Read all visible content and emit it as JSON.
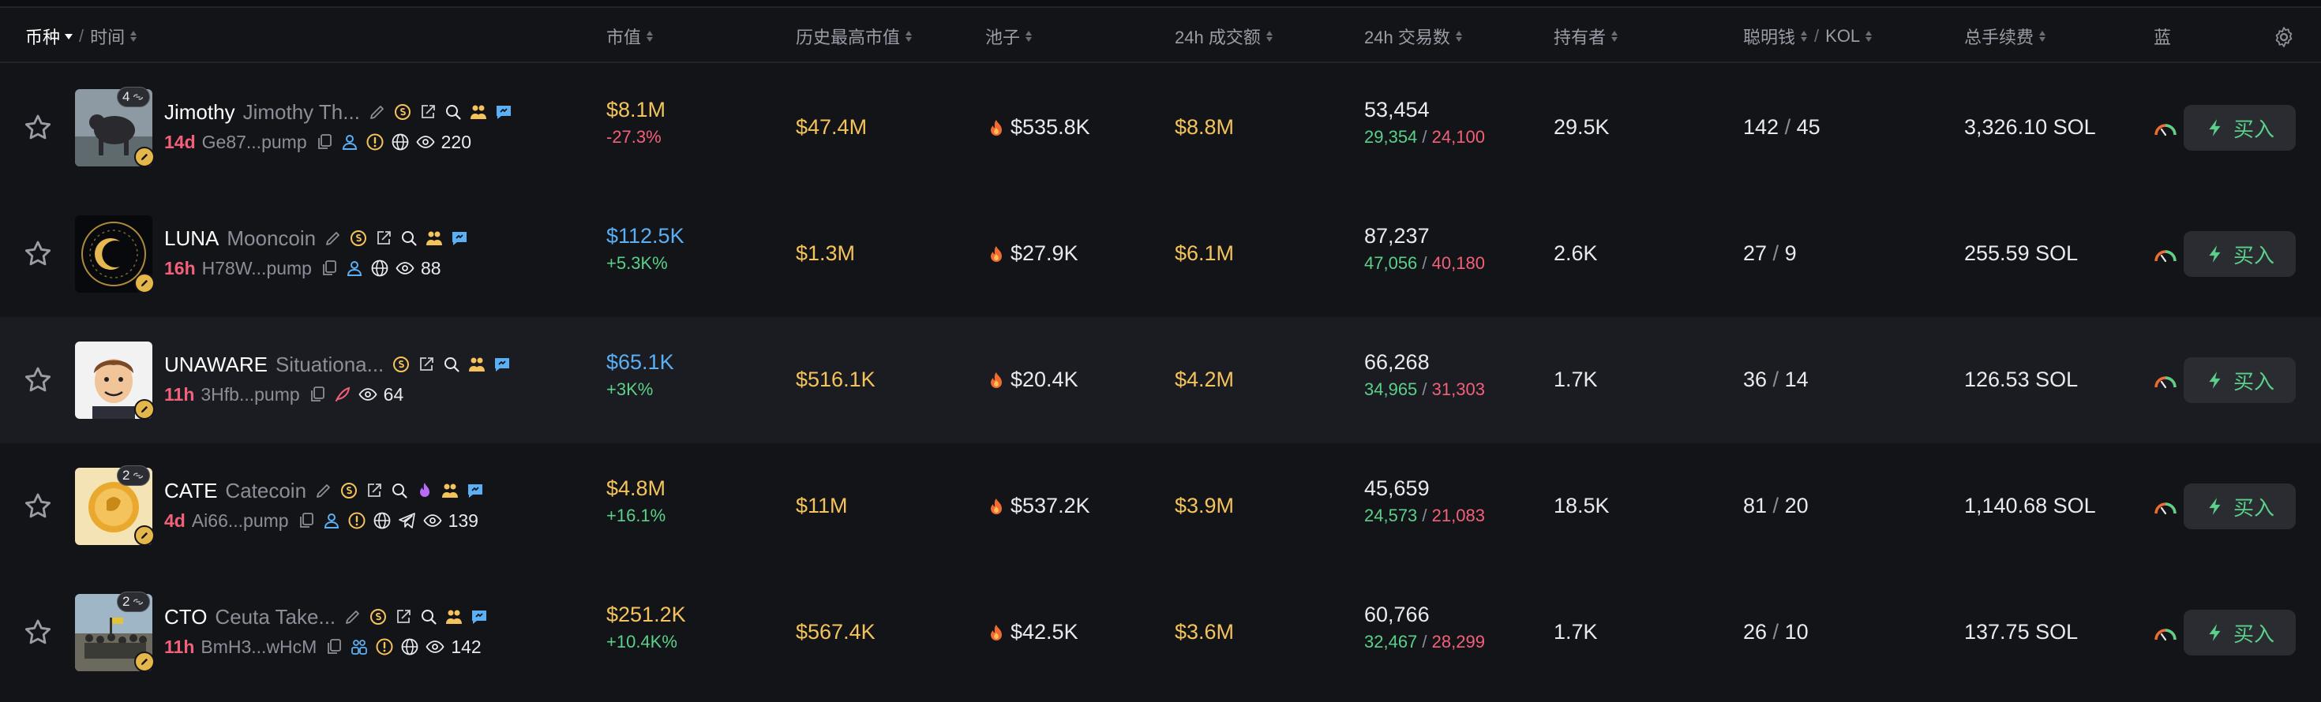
{
  "header": {
    "coin": "币种",
    "time": "时间",
    "market_cap": "市值",
    "ath_market_cap": "历史最高市值",
    "pool": "池子",
    "volume_24h": "24h 成交额",
    "txns_24h": "24h 交易数",
    "holders": "持有者",
    "smart_money": "聪明钱",
    "kol": "KOL",
    "total_fees": "总手续费",
    "bluechip": "蓝"
  },
  "buy_label": "买入",
  "colors": {
    "background": "#131418",
    "alt_row": "#1b1c21",
    "yellow": "#f5c35b",
    "blue": "#5bb0f5",
    "green": "#5ad089",
    "red": "#f3607a"
  },
  "rows": [
    {
      "symbol": "Jimothy",
      "name": "Jimothy Th...",
      "age": "14d",
      "address": "Ge87...pump",
      "views": "220",
      "badge": "4",
      "market_cap": "$8.1M",
      "mc_color": "yellow",
      "change": "-27.3%",
      "change_color": "red",
      "ath": "$47.4M",
      "pool": "$535.8K",
      "volume": "$8.8M",
      "txns": "53,454",
      "buys": "29,354",
      "sells": "24,100",
      "holders": "29.5K",
      "smart": "142",
      "kol": "45",
      "fees": "3,326.10 SOL",
      "icons": [
        "pencil-icon",
        "coin-icon",
        "share-icon",
        "search-icon",
        "people-icon",
        "chat-icon"
      ],
      "sub_icons": [
        "copy-icon",
        "user-icon",
        "alert-icon",
        "globe-icon",
        "eye-icon"
      ]
    },
    {
      "symbol": "LUNA",
      "name": "Mooncoin",
      "age": "16h",
      "address": "H78W...pump",
      "views": "88",
      "badge": "",
      "market_cap": "$112.5K",
      "mc_color": "blue",
      "change": "+5.3K%",
      "change_color": "green",
      "ath": "$1.3M",
      "pool": "$27.9K",
      "volume": "$6.1M",
      "txns": "87,237",
      "buys": "47,056",
      "sells": "40,180",
      "holders": "2.6K",
      "smart": "27",
      "kol": "9",
      "fees": "255.59 SOL",
      "icons": [
        "pencil-icon",
        "coin-icon",
        "share-icon",
        "search-icon",
        "people-icon",
        "chat-icon"
      ],
      "sub_icons": [
        "copy-icon",
        "user-icon",
        "globe-icon",
        "eye-icon"
      ]
    },
    {
      "symbol": "UNAWARE",
      "name": "Situationa...",
      "age": "11h",
      "address": "3Hfb...pump",
      "views": "64",
      "badge": "",
      "market_cap": "$65.1K",
      "mc_color": "blue",
      "change": "+3K%",
      "change_color": "green",
      "ath": "$516.1K",
      "pool": "$20.4K",
      "volume": "$4.2M",
      "txns": "66,268",
      "buys": "34,965",
      "sells": "31,303",
      "holders": "1.7K",
      "smart": "36",
      "kol": "14",
      "fees": "126.53 SOL",
      "icons": [
        "coin-icon",
        "share-icon",
        "search-icon",
        "people-icon",
        "chat-icon"
      ],
      "sub_icons": [
        "copy-icon",
        "feather-icon",
        "eye-icon"
      ]
    },
    {
      "symbol": "CATE",
      "name": "Catecoin",
      "age": "4d",
      "address": "Ai66...pump",
      "views": "139",
      "badge": "2",
      "market_cap": "$4.8M",
      "mc_color": "yellow",
      "change": "+16.1%",
      "change_color": "green",
      "ath": "$11M",
      "pool": "$537.2K",
      "volume": "$3.9M",
      "txns": "45,659",
      "buys": "24,573",
      "sells": "21,083",
      "holders": "18.5K",
      "smart": "81",
      "kol": "20",
      "fees": "1,140.68 SOL",
      "icons": [
        "pencil-icon",
        "coin-icon",
        "share-icon",
        "search-icon",
        "flame-icon",
        "people-icon",
        "chat-icon"
      ],
      "sub_icons": [
        "copy-icon",
        "user-icon",
        "alert-icon",
        "globe-icon",
        "telegram-icon",
        "eye-icon"
      ]
    },
    {
      "symbol": "CTO",
      "name": "Ceuta Take...",
      "age": "11h",
      "address": "BmH3...wHcM",
      "views": "142",
      "badge": "2",
      "market_cap": "$251.2K",
      "mc_color": "yellow",
      "change": "+10.4K%",
      "change_color": "green",
      "ath": "$567.4K",
      "pool": "$42.5K",
      "volume": "$3.6M",
      "txns": "60,766",
      "buys": "32,467",
      "sells": "28,299",
      "holders": "1.7K",
      "smart": "26",
      "kol": "10",
      "fees": "137.75 SOL",
      "icons": [
        "pencil-icon",
        "coin-icon",
        "share-icon",
        "search-icon",
        "people-icon",
        "chat-icon"
      ],
      "sub_icons": [
        "copy-icon",
        "group-icon",
        "alert-icon",
        "globe-icon",
        "eye-icon"
      ]
    }
  ]
}
